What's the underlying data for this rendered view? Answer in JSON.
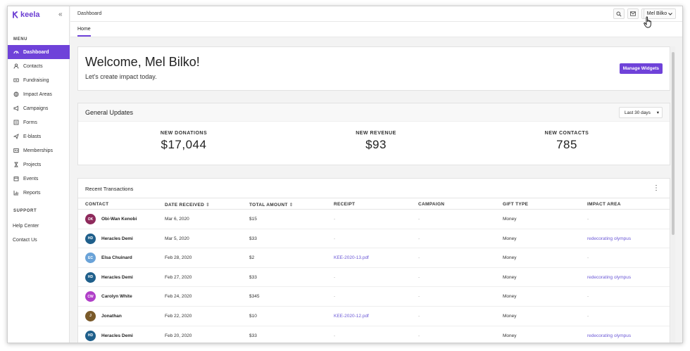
{
  "app": {
    "logo_text": "keela",
    "brand_color": "#6f42d9"
  },
  "sidebar": {
    "menu_label": "MENU",
    "items": [
      {
        "label": "Dashboard",
        "icon": "dashboard-icon",
        "active": true
      },
      {
        "label": "Contacts",
        "icon": "person-icon"
      },
      {
        "label": "Fundraising",
        "icon": "money-icon"
      },
      {
        "label": "Impact Areas",
        "icon": "globe-icon"
      },
      {
        "label": "Campaigns",
        "icon": "megaphone-icon"
      },
      {
        "label": "Forms",
        "icon": "form-icon"
      },
      {
        "label": "E-blasts",
        "icon": "send-icon"
      },
      {
        "label": "Memberships",
        "icon": "id-card-icon"
      },
      {
        "label": "Projects",
        "icon": "hourglass-icon"
      },
      {
        "label": "Events",
        "icon": "calendar-icon"
      },
      {
        "label": "Reports",
        "icon": "chart-icon"
      }
    ],
    "support_label": "SUPPORT",
    "support_items": [
      {
        "label": "Help Center"
      },
      {
        "label": "Contact Us"
      }
    ]
  },
  "topbar": {
    "title": "Dashboard",
    "user_name": "Mel Bilko"
  },
  "tabs": {
    "home": "Home"
  },
  "welcome": {
    "title": "Welcome, Mel Bilko!",
    "subtitle": "Let's create impact today.",
    "manage_button": "Manage Widgets"
  },
  "updates": {
    "title": "General Updates",
    "range": "Last 30 days",
    "stats": [
      {
        "label": "NEW DONATIONS",
        "value": "$17,044"
      },
      {
        "label": "NEW REVENUE",
        "value": "$93"
      },
      {
        "label": "NEW CONTACTS",
        "value": "785"
      }
    ]
  },
  "transactions": {
    "title": "Recent Transactions",
    "columns": [
      "CONTACT",
      "DATE RECEIVED",
      "TOTAL AMOUNT",
      "RECEIPT",
      "CAMPAIGN",
      "GIFT TYPE",
      "IMPACT AREA"
    ],
    "rows": [
      {
        "initials": "OK",
        "color": "#8e2a5c",
        "name": "Obi-Wan Kenobi",
        "date": "Mar 6, 2020",
        "amount": "$15",
        "receipt": "-",
        "campaign": "-",
        "gift": "Money",
        "impact": "-"
      },
      {
        "initials": "HD",
        "color": "#1f5f8b",
        "name": "Heracles Demi",
        "date": "Mar 5, 2020",
        "amount": "$33",
        "receipt": "-",
        "campaign": "-",
        "gift": "Money",
        "impact": "redecorating olympus"
      },
      {
        "initials": "EC",
        "color": "#6aa3d8",
        "name": "Elsa Chuinard",
        "date": "Feb 28, 2020",
        "amount": "$2",
        "receipt": "KEE-2020-13.pdf",
        "campaign": "-",
        "gift": "Money",
        "impact": "-"
      },
      {
        "initials": "HD",
        "color": "#1f5f8b",
        "name": "Heracles Demi",
        "date": "Feb 27, 2020",
        "amount": "$33",
        "receipt": "-",
        "campaign": "-",
        "gift": "Money",
        "impact": "redecorating olympus"
      },
      {
        "initials": "CW",
        "color": "#b03fc8",
        "name": "Carolyn White",
        "date": "Feb 24, 2020",
        "amount": "$345",
        "receipt": "-",
        "campaign": "-",
        "gift": "Money",
        "impact": "-"
      },
      {
        "initials": "J",
        "color": "#7a5a2a",
        "name": "Jonathan",
        "date": "Feb 22, 2020",
        "amount": "$10",
        "receipt": "KEE-2020-12.pdf",
        "campaign": "-",
        "gift": "Money",
        "impact": "-"
      },
      {
        "initials": "HD",
        "color": "#1f5f8b",
        "name": "Heracles Demi",
        "date": "Feb 20, 2020",
        "amount": "$33",
        "receipt": "-",
        "campaign": "-",
        "gift": "Money",
        "impact": "redecorating olympus"
      }
    ]
  }
}
